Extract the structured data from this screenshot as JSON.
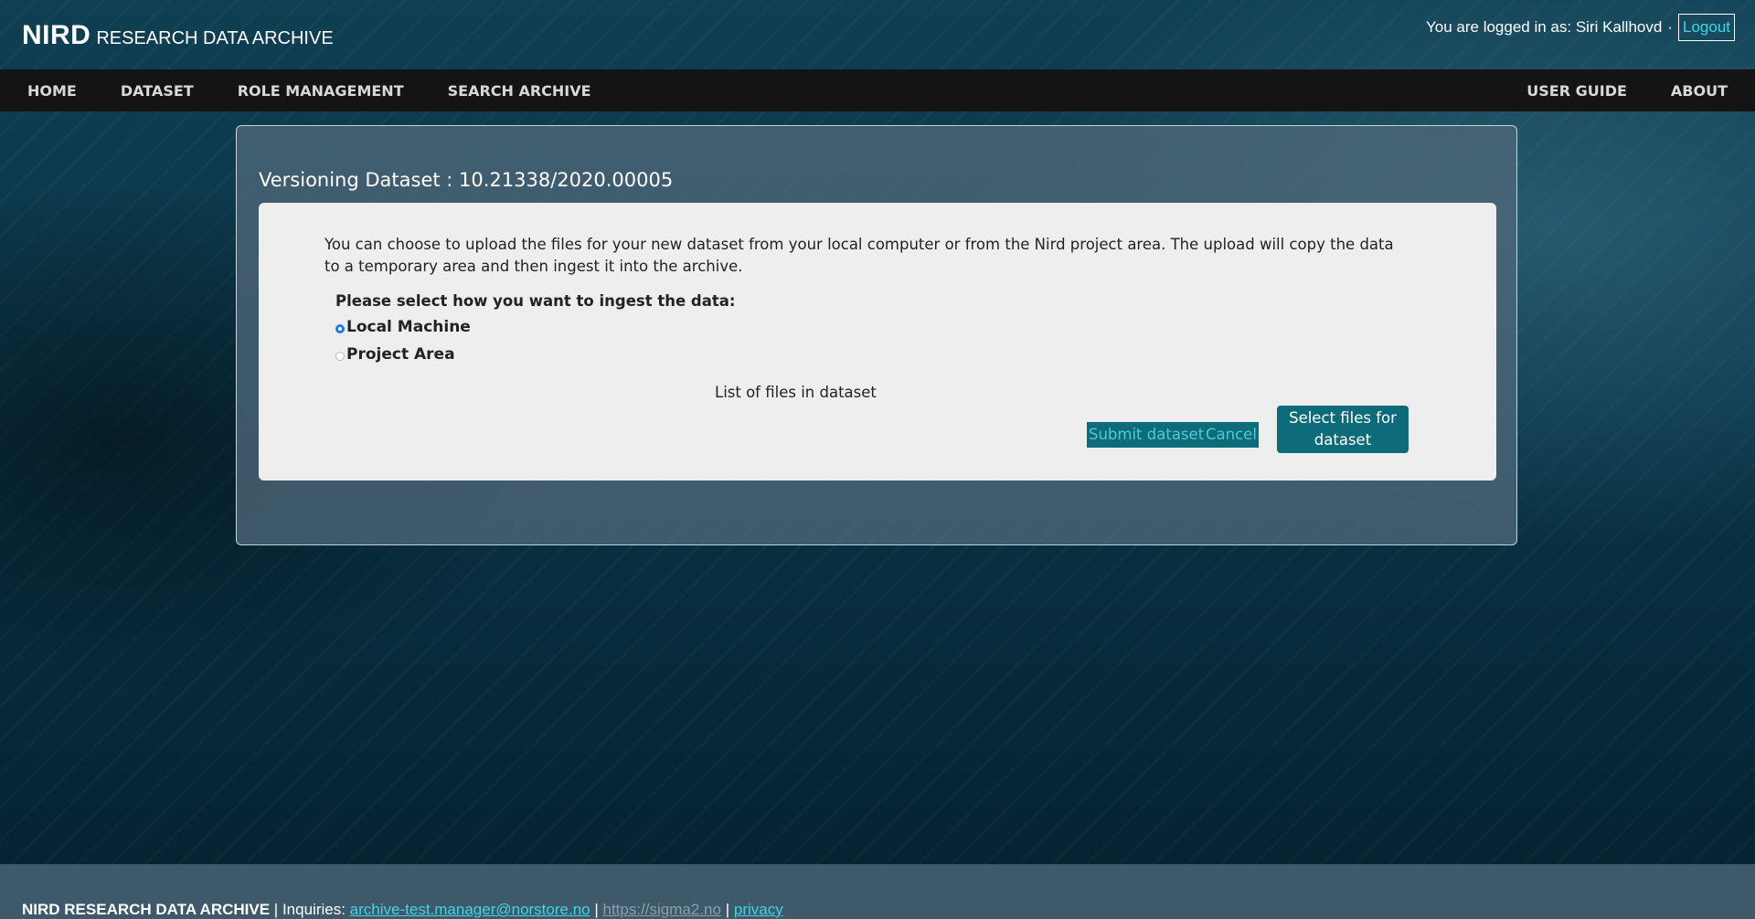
{
  "header": {
    "brand_main": "NIRD",
    "brand_sub": "RESEARCH DATA ARCHIVE",
    "user_text": "You are logged in as: Siri Kallhovd",
    "separator": "·",
    "logout_label": "Logout"
  },
  "nav": {
    "left": [
      {
        "label": "HOME"
      },
      {
        "label": "DATASET"
      },
      {
        "label": "ROLE MANAGEMENT"
      },
      {
        "label": "SEARCH ARCHIVE"
      }
    ],
    "right": [
      {
        "label": "USER GUIDE"
      },
      {
        "label": "ABOUT"
      }
    ]
  },
  "panel": {
    "title": "Versioning Dataset : 10.21338/2020.00005",
    "intro": "You can choose to upload the files for your new dataset from your local computer or from the Nird project area. The upload will copy the data to a temporary area and then ingest it into the archive.",
    "choose_label": "Please select how you want to ingest the data:",
    "options": [
      {
        "label": "Local Machine",
        "selected": true
      },
      {
        "label": "Project Area",
        "selected": false
      }
    ],
    "files_label": "List of files in dataset",
    "submit_label": "Submit dataset",
    "cancel_label": "Cancel",
    "select_files_label": "Select files for dataset"
  },
  "footer": {
    "brand": "NIRD RESEARCH DATA ARCHIVE",
    "sep": "|",
    "inquiries": "Inquiries:",
    "email": "archive-test.manager@norstore.no",
    "url": "https://sigma2.no",
    "privacy": "privacy"
  },
  "colors": {
    "accent": "#0d6b7a",
    "link": "#3fd6e8",
    "nav_bg": "#141414",
    "radio_selected": "#1a7cf0"
  }
}
